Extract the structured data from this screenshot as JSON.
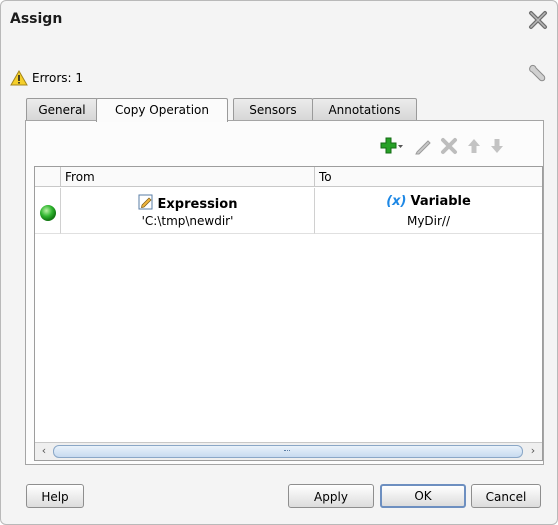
{
  "dialog": {
    "title": "Assign"
  },
  "status": {
    "errors_text": "Errors: 1"
  },
  "tabs": [
    {
      "label": "General"
    },
    {
      "label": "Copy Operation",
      "active": true
    },
    {
      "label": "Sensors"
    },
    {
      "label": "Annotations"
    }
  ],
  "table": {
    "headers": {
      "from": "From",
      "to": "To"
    },
    "rows": [
      {
        "status": "valid",
        "from_type": "Expression",
        "from_value": "'C:\\tmp\\newdir'",
        "to_icon": "(x)",
        "to_type": "Variable",
        "to_value": "MyDir//"
      }
    ]
  },
  "buttons": {
    "help": "Help",
    "apply": "Apply",
    "ok": "OK",
    "cancel": "Cancel"
  },
  "colors": {
    "accent": "#1e88e5",
    "status_green": "#2fb52f",
    "add_green": "#27a127"
  }
}
